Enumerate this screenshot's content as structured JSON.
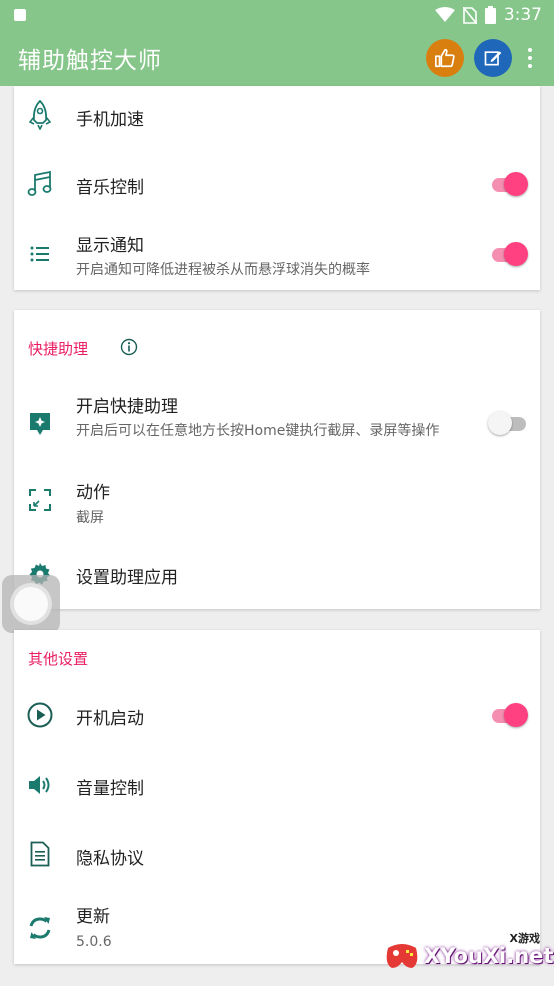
{
  "status_bar": {
    "time": "3:37"
  },
  "app_bar": {
    "title": "辅助触控大师",
    "like_icon": "thumb-up-icon",
    "edit_icon": "edit-icon",
    "menu_icon": "more-vert-icon",
    "like_color": "#d97f10",
    "edit_color": "#1f67b8"
  },
  "theme": {
    "primary": "#86c68a",
    "accent": "#ff4081",
    "icon": "#1b7a6e"
  },
  "card1": {
    "items": [
      {
        "title": "手机加速",
        "icon": "rocket-icon"
      },
      {
        "title": "音乐控制",
        "icon": "music-note-icon",
        "switch": true
      },
      {
        "title": "显示通知",
        "subtitle": "开启通知可降低进程被杀从而悬浮球消失的概率",
        "icon": "list-icon",
        "switch": true
      }
    ]
  },
  "card2": {
    "header": "快捷助理",
    "header_icon": "info-icon",
    "items": [
      {
        "title": "开启快捷助理",
        "subtitle": "开启后可以在任意地方长按Home键执行截屏、录屏等操作",
        "icon": "assistant-icon",
        "switch": false
      },
      {
        "title": "动作",
        "subtitle": "截屏",
        "icon": "crop-free-icon"
      },
      {
        "title": "设置助理应用",
        "icon": "settings-icon"
      }
    ]
  },
  "card3": {
    "header": "其他设置",
    "items": [
      {
        "title": "开机启动",
        "icon": "play-circle-icon",
        "switch": true
      },
      {
        "title": "音量控制",
        "icon": "volume-icon"
      },
      {
        "title": "隐私协议",
        "icon": "document-icon"
      },
      {
        "title": "更新",
        "subtitle": "5.0.6",
        "icon": "sync-icon"
      }
    ]
  },
  "watermark": {
    "text": "XYouXi.net",
    "small": "X游戏"
  }
}
